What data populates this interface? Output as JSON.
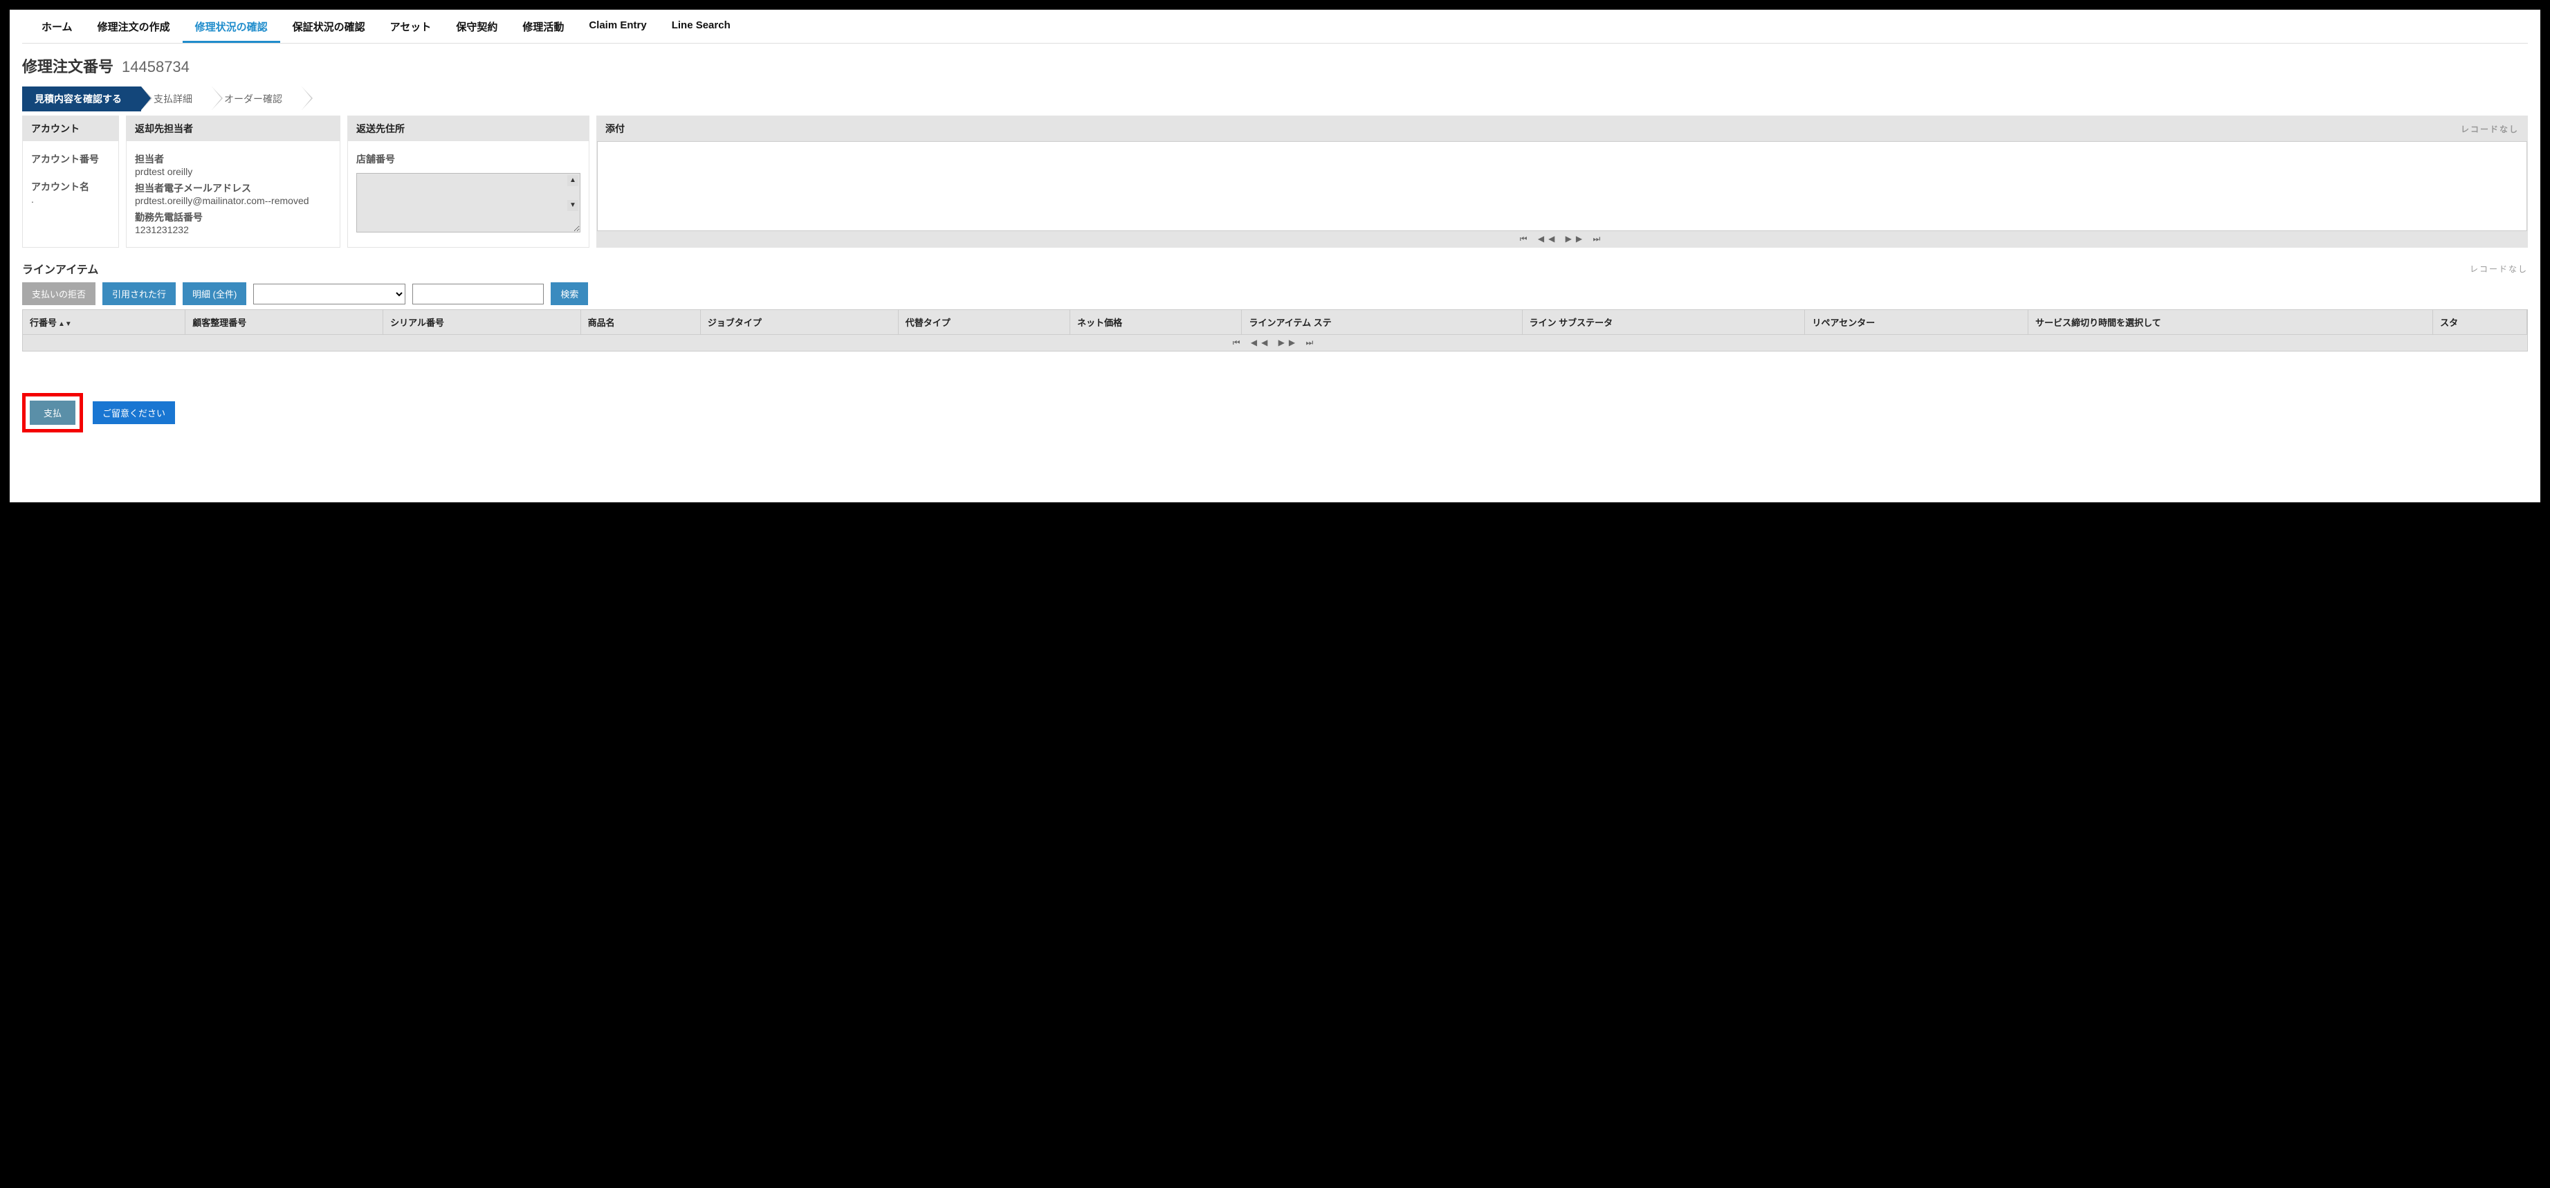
{
  "nav": {
    "tabs": [
      {
        "label": "ホーム",
        "active": false
      },
      {
        "label": "修理注文の作成",
        "active": false
      },
      {
        "label": "修理状況の確認",
        "active": true
      },
      {
        "label": "保証状況の確認",
        "active": false
      },
      {
        "label": "アセット",
        "active": false
      },
      {
        "label": "保守契約",
        "active": false
      },
      {
        "label": "修理活動",
        "active": false
      },
      {
        "label": "Claim Entry",
        "active": false
      },
      {
        "label": "Line Search",
        "active": false
      }
    ]
  },
  "title": {
    "label": "修理注文番号",
    "value": "14458734"
  },
  "wizard": {
    "steps": [
      {
        "label": "見積内容を確認する",
        "active": true
      },
      {
        "label": "支払詳細",
        "active": false
      },
      {
        "label": "オーダー確認",
        "active": false
      }
    ]
  },
  "cards": {
    "account": {
      "header": "アカウント",
      "acct_no_lbl": "アカウント番号",
      "acct_name_lbl": "アカウント名"
    },
    "contact": {
      "header": "返却先担当者",
      "person_lbl": "担当者",
      "person_val": "prdtest oreilly",
      "email_lbl": "担当者電子メールアドレス",
      "email_val": "prdtest.oreilly@mailinator.com--removed",
      "phone_lbl": "勤務先電話番号",
      "phone_val": "1231231232"
    },
    "address": {
      "header": "返送先住所",
      "store_lbl": "店舗番号"
    },
    "attach": {
      "header": "添付",
      "no_records": "レコードなし"
    }
  },
  "line_section": {
    "title": "ラインアイテム",
    "no_records": "レコードなし",
    "btn_reject": "支払いの拒否",
    "btn_quoted": "引用された行",
    "btn_detail": "明細 (全件)",
    "btn_search": "検索",
    "columns": [
      "行番号",
      "顧客整理番号",
      "シリアル番号",
      "商品名",
      "ジョブタイプ",
      "代替タイプ",
      "ネット価格",
      "ラインアイテム ステ",
      "ライン サブステータ",
      "リペアセンター",
      "サービス締切り時間を選択して",
      "スタ"
    ]
  },
  "footer": {
    "pay": "支払",
    "note": "ご留意ください"
  }
}
